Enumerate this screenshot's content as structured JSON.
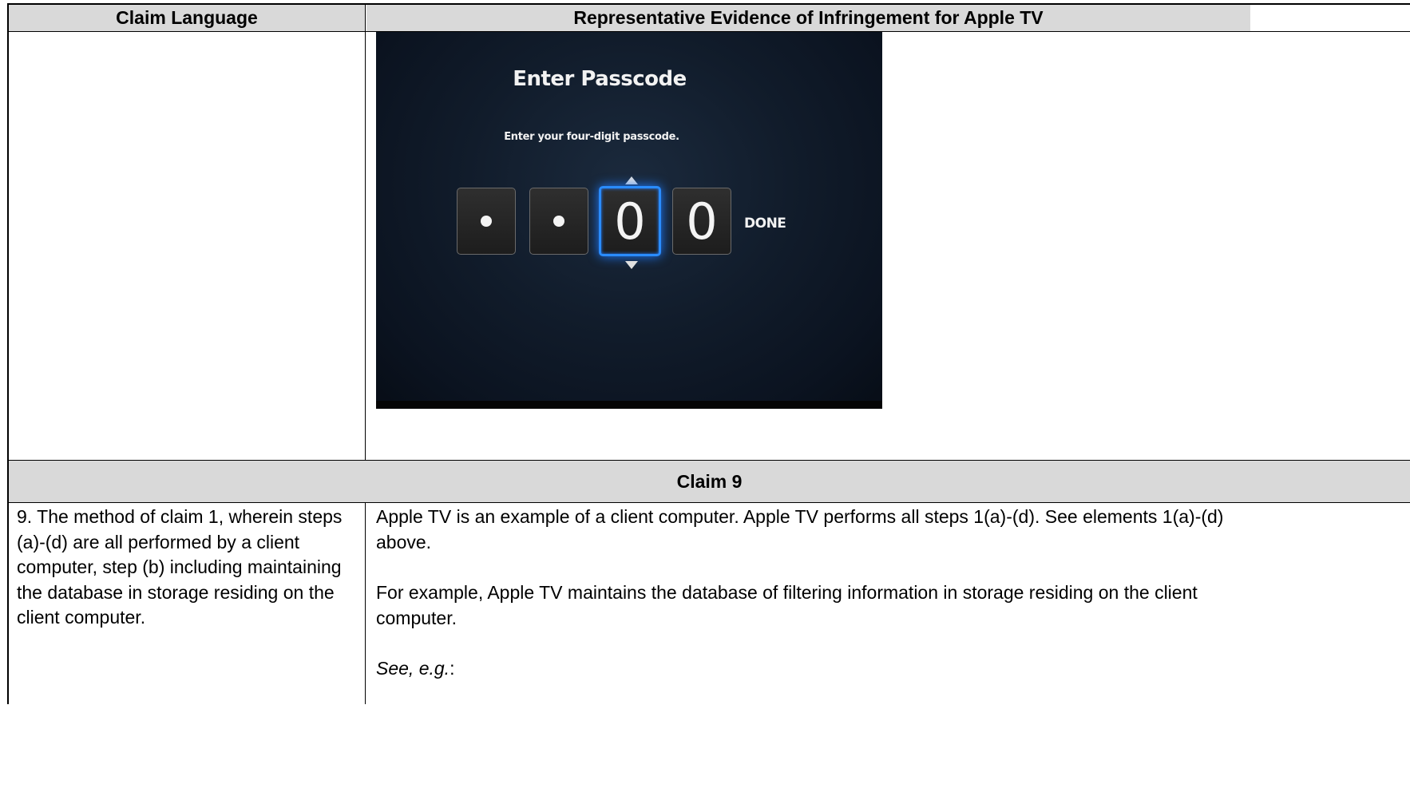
{
  "table": {
    "header_left": "Claim Language",
    "header_right": "Representative Evidence of Infringement for Apple TV",
    "claim_row": "Claim 9",
    "claim_text": "9. The method of claim 1, wherein steps (a)-(d) are all performed by a client computer, step (b) including maintaining the database in storage residing on the client computer.",
    "evidence": {
      "para1": "Apple TV is an example of a client computer.  Apple TV performs all steps 1(a)-(d).  See elements 1(a)-(d) above.",
      "para2": "For example, Apple TV maintains the database of filtering information in storage residing on the client computer.",
      "see_italic": "See, e.g.",
      "see_suffix": ":"
    }
  },
  "screenshot": {
    "title": "Enter Passcode",
    "subtitle": "Enter your four-digit passcode.",
    "digits": [
      "•",
      "•",
      "0",
      "0"
    ],
    "active_index": 2,
    "done_label": "DONE",
    "accent_color": "#2a8cff"
  }
}
